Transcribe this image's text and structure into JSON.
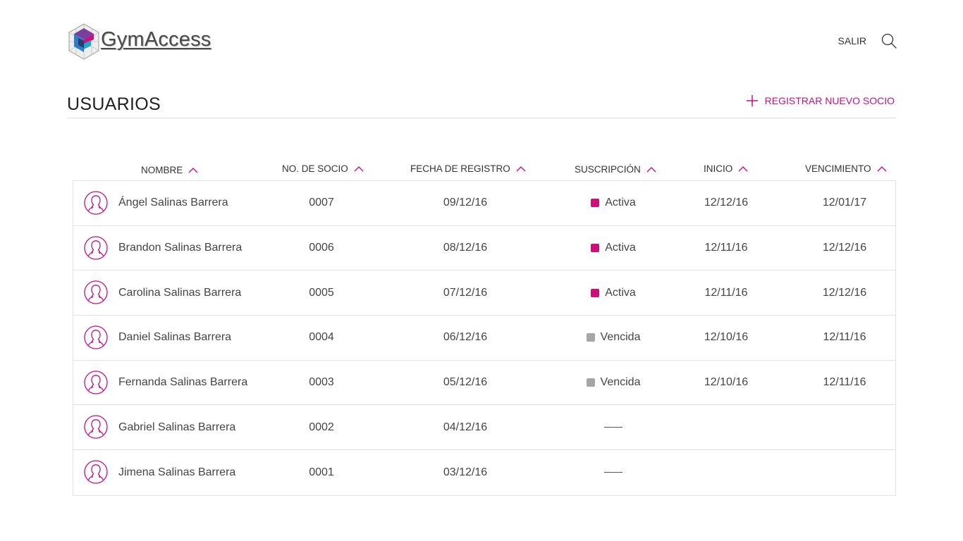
{
  "brand": {
    "name": "GymAccess"
  },
  "header": {
    "logout_label": "SALIR"
  },
  "page": {
    "title": "USUARIOS",
    "register_label": "REGISTRAR NUEVO SOCIO"
  },
  "colors": {
    "accent": "#c8107e",
    "active": "#c8107e",
    "expired": "#a6a6a6"
  },
  "table": {
    "columns": [
      "NOMBRE",
      "NO. DE SOCIO",
      "FECHA DE REGISTRO",
      "SUSCRIPCIÓN",
      "INICIO",
      "VENCIMIENTO"
    ],
    "rows": [
      {
        "name": "Ángel Salinas Barrera",
        "number": "0007",
        "registered": "09/12/16",
        "subscription": "Activa",
        "status": "active",
        "start": "12/12/16",
        "end": "12/01/17"
      },
      {
        "name": "Brandon Salinas Barrera",
        "number": "0006",
        "registered": "08/12/16",
        "subscription": "Activa",
        "status": "active",
        "start": "12/11/16",
        "end": "12/12/16"
      },
      {
        "name": "Carolina Salinas Barrera",
        "number": "0005",
        "registered": "07/12/16",
        "subscription": "Activa",
        "status": "active",
        "start": "12/11/16",
        "end": "12/12/16"
      },
      {
        "name": "Daniel Salinas Barrera",
        "number": "0004",
        "registered": "06/12/16",
        "subscription": "Vencida",
        "status": "expired",
        "start": "12/10/16",
        "end": "12/11/16"
      },
      {
        "name": "Fernanda Salinas Barrera",
        "number": "0003",
        "registered": "05/12/16",
        "subscription": "Vencida",
        "status": "expired",
        "start": "12/10/16",
        "end": "12/11/16"
      },
      {
        "name": "Gabriel Salinas Barrera",
        "number": "0002",
        "registered": "04/12/16",
        "subscription": "",
        "status": "none",
        "start": "",
        "end": ""
      },
      {
        "name": "Jimena Salinas Barrera",
        "number": "0001",
        "registered": "03/12/16",
        "subscription": "",
        "status": "none",
        "start": "",
        "end": ""
      }
    ]
  }
}
